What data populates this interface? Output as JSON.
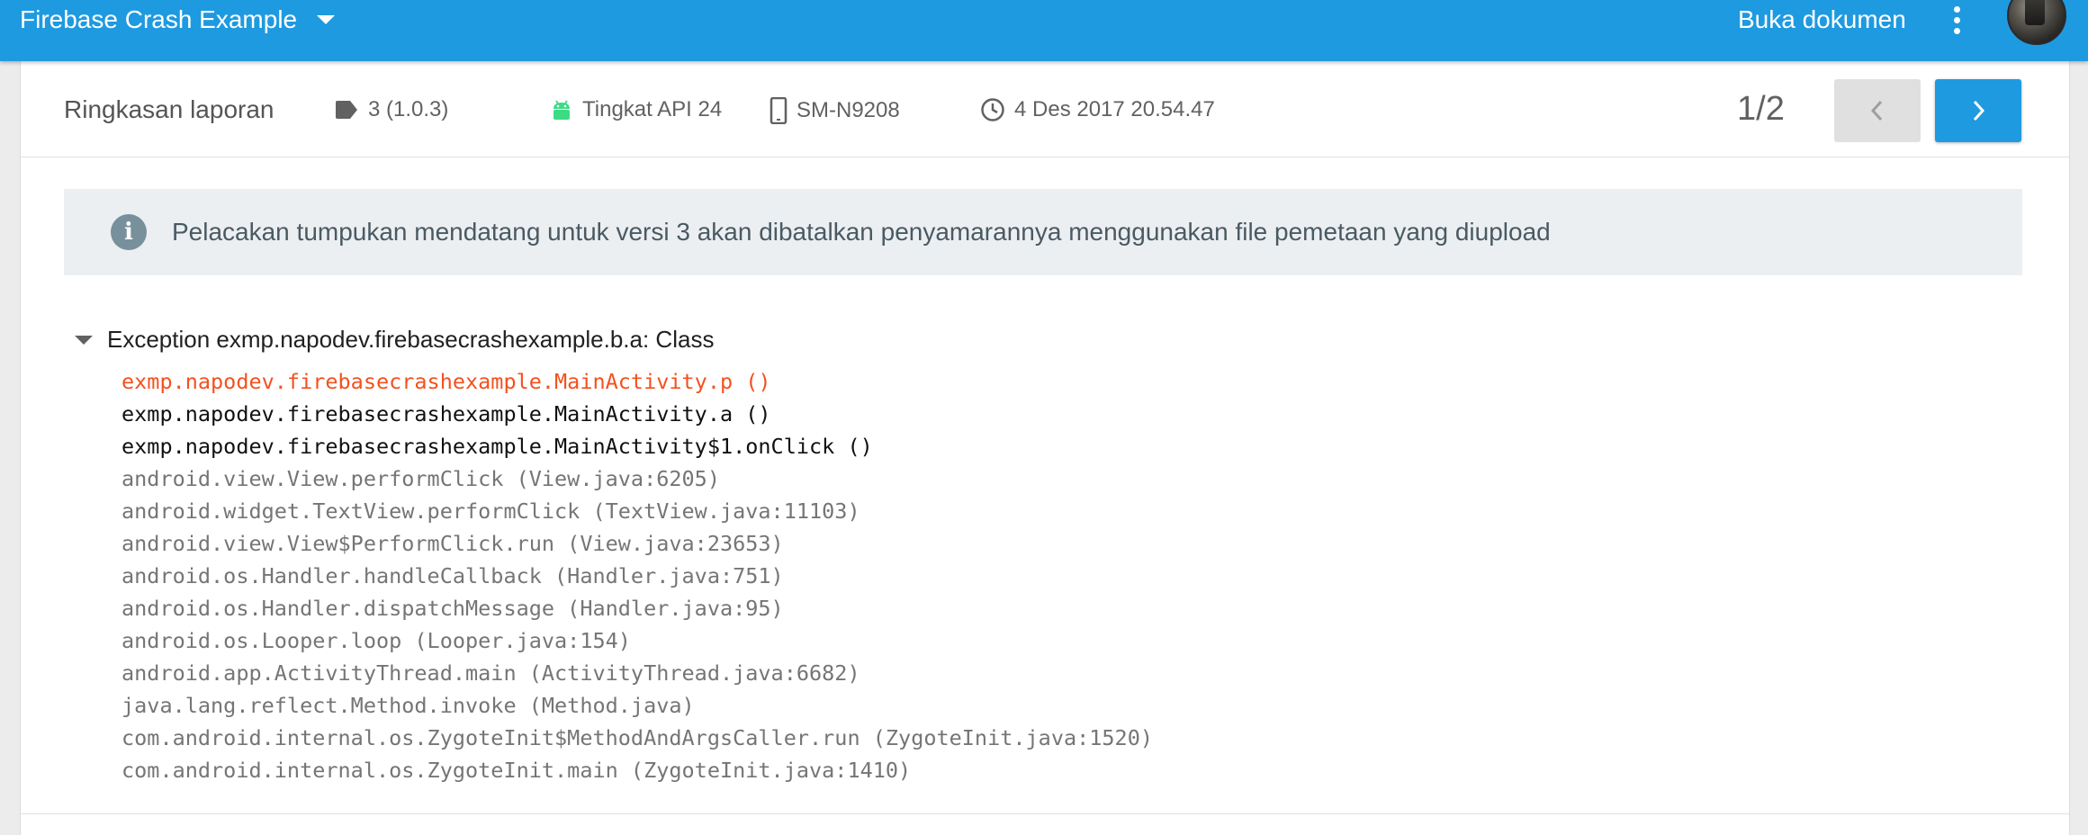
{
  "topbar": {
    "app_title": "Firebase Crash Example",
    "open_docs": "Buka dokumen"
  },
  "summary": {
    "title": "Ringkasan laporan",
    "version": "3 (1.0.3)",
    "api_level": "Tingkat API 24",
    "device": "SM-N9208",
    "timestamp": "4 Des 2017 20.54.47",
    "pager": "1/2"
  },
  "banner": {
    "icon": "i",
    "text": "Pelacakan tumpukan mendatang untuk versi 3 akan dibatalkan penyamarannya menggunakan file pemetaan yang diupload"
  },
  "exception": {
    "title": "Exception exmp.napodev.firebasecrashexample.b.a: Class",
    "frames": [
      {
        "text": "exmp.napodev.firebasecrashexample.MainActivity.p ()",
        "kind": "crash"
      },
      {
        "text": "exmp.napodev.firebasecrashexample.MainActivity.a ()",
        "kind": "app"
      },
      {
        "text": "exmp.napodev.firebasecrashexample.MainActivity$1.onClick ()",
        "kind": "app"
      },
      {
        "text": "android.view.View.performClick (View.java:6205)",
        "kind": "framework"
      },
      {
        "text": "android.widget.TextView.performClick (TextView.java:11103)",
        "kind": "framework"
      },
      {
        "text": "android.view.View$PerformClick.run (View.java:23653)",
        "kind": "framework"
      },
      {
        "text": "android.os.Handler.handleCallback (Handler.java:751)",
        "kind": "framework"
      },
      {
        "text": "android.os.Handler.dispatchMessage (Handler.java:95)",
        "kind": "framework"
      },
      {
        "text": "android.os.Looper.loop (Looper.java:154)",
        "kind": "framework"
      },
      {
        "text": "android.app.ActivityThread.main (ActivityThread.java:6682)",
        "kind": "framework"
      },
      {
        "text": "java.lang.reflect.Method.invoke (Method.java)",
        "kind": "framework"
      },
      {
        "text": "com.android.internal.os.ZygoteInit$MethodAndArgsCaller.run (ZygoteInit.java:1520)",
        "kind": "framework"
      },
      {
        "text": "com.android.internal.os.ZygoteInit.main (ZygoteInit.java:1410)",
        "kind": "framework"
      }
    ]
  },
  "colors": {
    "brand": "#1e9ae0",
    "crash_frame": "#f4511e",
    "android_green": "#3ddc84"
  },
  "icons": [
    "chevron-down-icon",
    "more-vert-icon",
    "label-tag-icon",
    "android-icon",
    "phone-icon",
    "clock-icon",
    "chevron-left-icon",
    "chevron-right-icon",
    "info-icon",
    "triangle-down-icon"
  ]
}
